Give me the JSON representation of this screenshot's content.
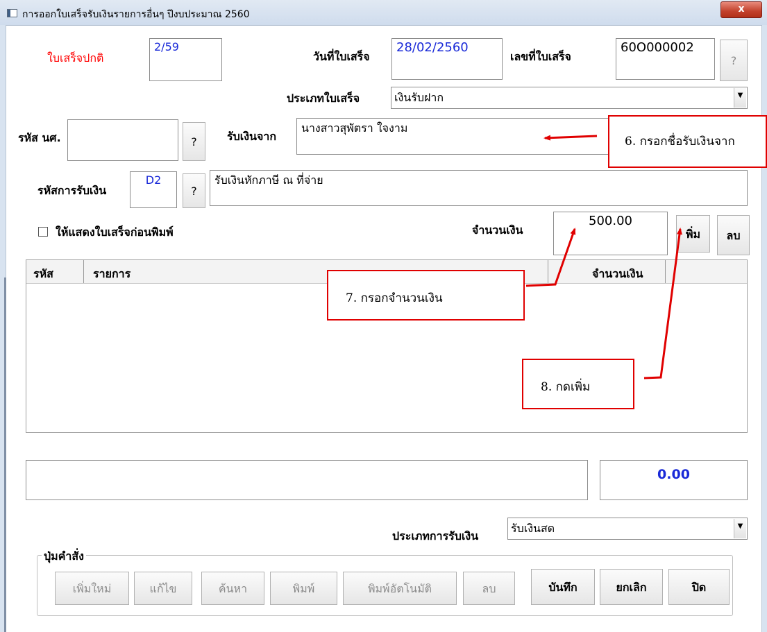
{
  "window": {
    "title": "การออกใบเสร็จรับเงินรายการอื่นๆ ปีงบประมาณ 2560",
    "close_label": "x"
  },
  "form": {
    "receipt_type_label": "ใบเสร็จปกติ",
    "receipt_type_value": "2/59",
    "receipt_date_label": "วันที่ใบเสร็จ",
    "receipt_date_value": "28/02/2560",
    "receipt_no_label": "เลขที่ใบเสร็จ",
    "receipt_no_value": "60O000002",
    "help_btn": "?",
    "category_label": "ประเภทใบเสร็จ",
    "category_value": "เงินรับฝาก",
    "student_code_label": "รหัส นศ.",
    "student_code_value": "",
    "received_from_label": "รับเงินจาก",
    "received_from_value": "นางสาวสุพัตรา ใจงาม",
    "income_code_label": "รหัสการรับเงิน",
    "income_code_value": "D2",
    "income_desc_value": "รับเงินหักภาษี ณ ที่จ่าย",
    "preview_checkbox_label": "ให้แสดงใบเสร็จก่อนพิมพ์",
    "amount_label": "จำนวนเงิน",
    "amount_value": "500.00",
    "add_btn": "พิ่ม",
    "delete_btn": "ลบ"
  },
  "grid": {
    "col_code": "รหัส",
    "col_item": "รายการ",
    "col_amount": "จำนวนเงิน"
  },
  "summary": {
    "note_value": "",
    "total_value": "0.00"
  },
  "payment": {
    "label": "ประเภทการรับเงิน",
    "value": "รับเงินสด"
  },
  "commands": {
    "group_label": "ปุ่มคำสั่ง",
    "buttons": [
      "เพิ่มใหม่",
      "แก้ไข",
      "ค้นหา",
      "พิมพ์",
      "พิมพ์อัตโนมัติ",
      "ลบ",
      "บันทึก",
      "ยกเลิก",
      "ปิด"
    ]
  },
  "annotations": {
    "step6": "6. กรอกชื่อรับเงินจาก",
    "step7": "7. กรอกจำนวนเงิน",
    "step8": "8. กดเพิ่ม"
  },
  "colors": {
    "annotation": "#e00000",
    "value_text": "#1a2ad8",
    "receipt_type_label": "#ff0000"
  }
}
